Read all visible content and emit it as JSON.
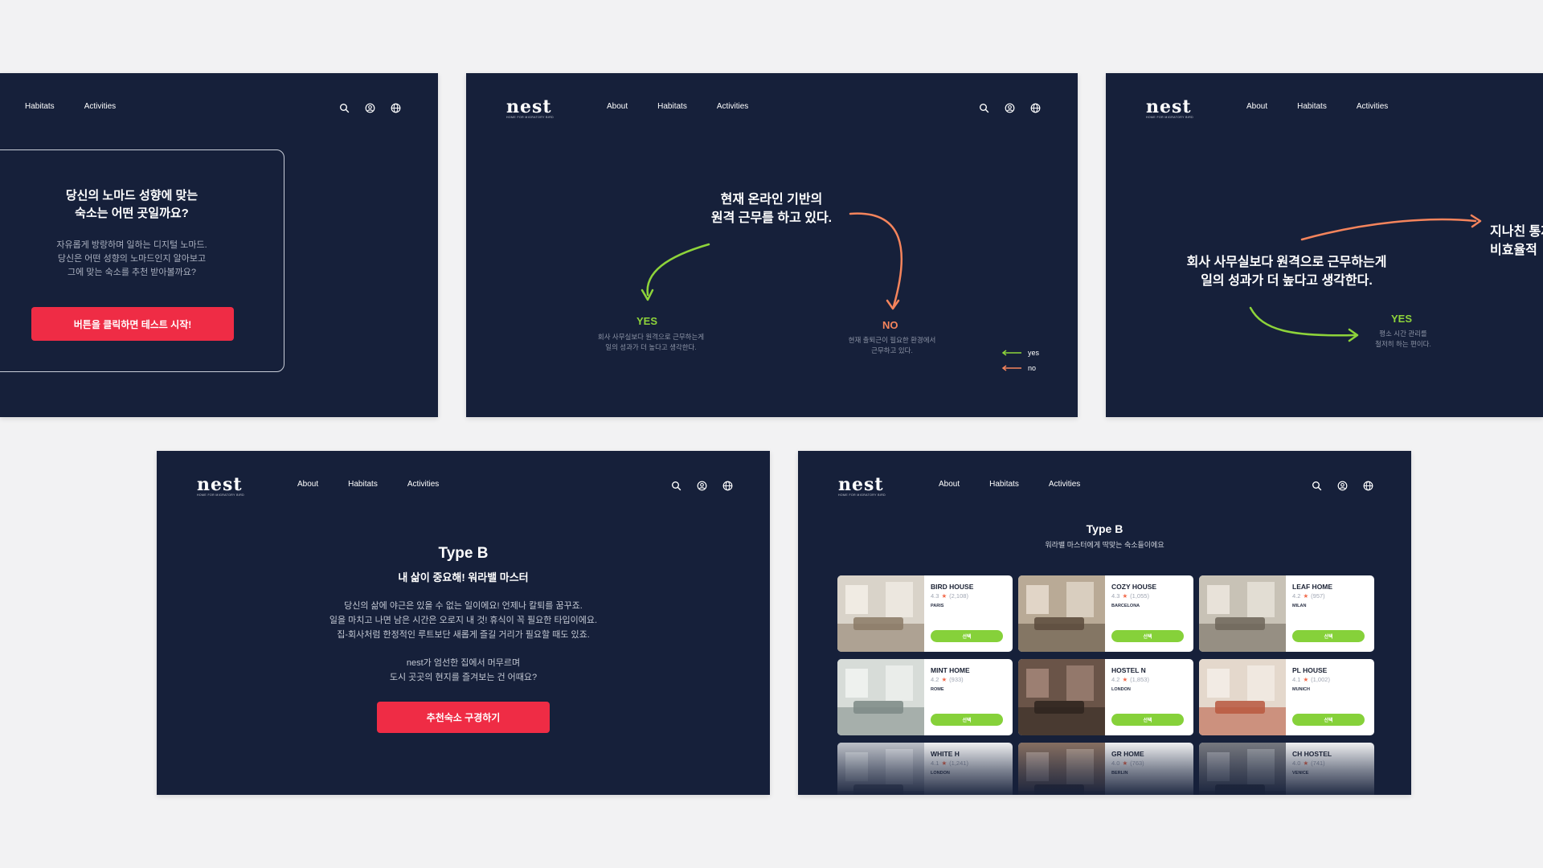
{
  "brand": {
    "logo": "nest",
    "tagline": "home for migratory bird"
  },
  "nav": {
    "about": "About",
    "habitats": "Habitats",
    "activities": "Activities"
  },
  "icons": [
    "search-icon",
    "user-icon",
    "globe-icon"
  ],
  "screen1": {
    "title": "당신의 노마드 성향에 맞는\n숙소는 어떤 곳일까요?",
    "description": "자유롭게 방랑하며 일하는 디지털 노마드.\n당신은 어떤 성향의 노마드인지 알아보고\n그에 맞는 숙소를 추천 받아볼까요?",
    "start_button": "버튼을 클릭하면 테스트 시작!"
  },
  "screen2": {
    "question": "현재 온라인 기반의\n원격 근무를 하고 있다.",
    "yes": "YES",
    "yes_desc": "회사 사무실보다 원격으로 근무하는게\n일의 성과가 더 높다고 생각한다.",
    "no": "NO",
    "no_desc": "현재 출퇴근이 필요한 환경에서\n근무하고 있다.",
    "legend_yes": "yes",
    "legend_no": "no"
  },
  "screen3": {
    "question": "회사 사무실보다 원격으로 근무하는게\n일의 성과가 더 높다고 생각한다.",
    "right_text": "지나친 통제\n비효율적",
    "yes": "YES",
    "yes_desc": "평소 시간 관리를\n철저히 하는 편이다."
  },
  "screen4": {
    "title": "Type B",
    "subtitle": "내 삶이 중요해! 워라밸 마스터",
    "body": "당신의 삶에 야근은 있을 수 없는 일이에요! 언제나 칼퇴를 꿈꾸죠.\n일을 마치고 나면 남은 시간은 오로지 내 것! 휴식이 꼭 필요한 타입이에요.\n집-회사처럼 한정적인 루트보단 새롭게 즐길 거리가 필요할 때도 있죠.",
    "body2": "nest가 엄선한 집에서 머무르며\n도시 곳곳의 현지를 즐겨보는 건 어때요?",
    "button": "추천숙소 구경하기"
  },
  "screen5": {
    "title": "Type B",
    "subtitle": "워라밸 마스터에게 딱맞는 숙소들이에요",
    "select_label": "선택",
    "houses": [
      {
        "name": "BIRD HOUSE",
        "rating": "4.3",
        "reviews": "(2,108)",
        "city": "PARIS",
        "palette": [
          "#d9d3c9",
          "#8b7a66",
          "#f3efe8"
        ]
      },
      {
        "name": "COZY HOUSE",
        "rating": "4.3",
        "reviews": "(1,055)",
        "city": "BARCELONA",
        "palette": [
          "#b9aa96",
          "#5a4b3c",
          "#e7ddd0"
        ]
      },
      {
        "name": "LEAF HOME",
        "rating": "4.2",
        "reviews": "(957)",
        "city": "MILAN",
        "palette": [
          "#c8c2b6",
          "#6e665a",
          "#ede8df"
        ]
      },
      {
        "name": "MINT HOME",
        "rating": "4.2",
        "reviews": "(933)",
        "city": "ROME",
        "palette": [
          "#d7dcd8",
          "#7d8a86",
          "#f2f4f2"
        ]
      },
      {
        "name": "HOSTEL N",
        "rating": "4.2",
        "reviews": "(1,853)",
        "city": "LONDON",
        "palette": [
          "#6a5448",
          "#2e241f",
          "#a5877a"
        ]
      },
      {
        "name": "PL HOUSE",
        "rating": "4.1",
        "reviews": "(1,002)",
        "city": "MUNICH",
        "palette": [
          "#e4d8cc",
          "#b8583e",
          "#f5efe8"
        ]
      },
      {
        "name": "WHITE H",
        "rating": "4.1",
        "reviews": "(1,241)",
        "city": "LONDON",
        "palette": [
          "#c9ccd2",
          "#6b707b",
          "#eceef1"
        ]
      },
      {
        "name": "GR HOME",
        "rating": "4.0",
        "reviews": "(763)",
        "city": "BERLIN",
        "palette": [
          "#8f7564",
          "#3b2e27",
          "#c9b3a3"
        ]
      },
      {
        "name": "CH HOSTEL",
        "rating": "4.0",
        "reviews": "(741)",
        "city": "VENICE",
        "palette": [
          "#7e7f84",
          "#2f3035",
          "#b5b6ba"
        ]
      }
    ]
  },
  "colors": {
    "panel": "#16203a",
    "page": "#f2f2f3",
    "accent_red": "#ef2c45",
    "yes_green": "#8ed43a",
    "no_orange": "#f5845c"
  }
}
